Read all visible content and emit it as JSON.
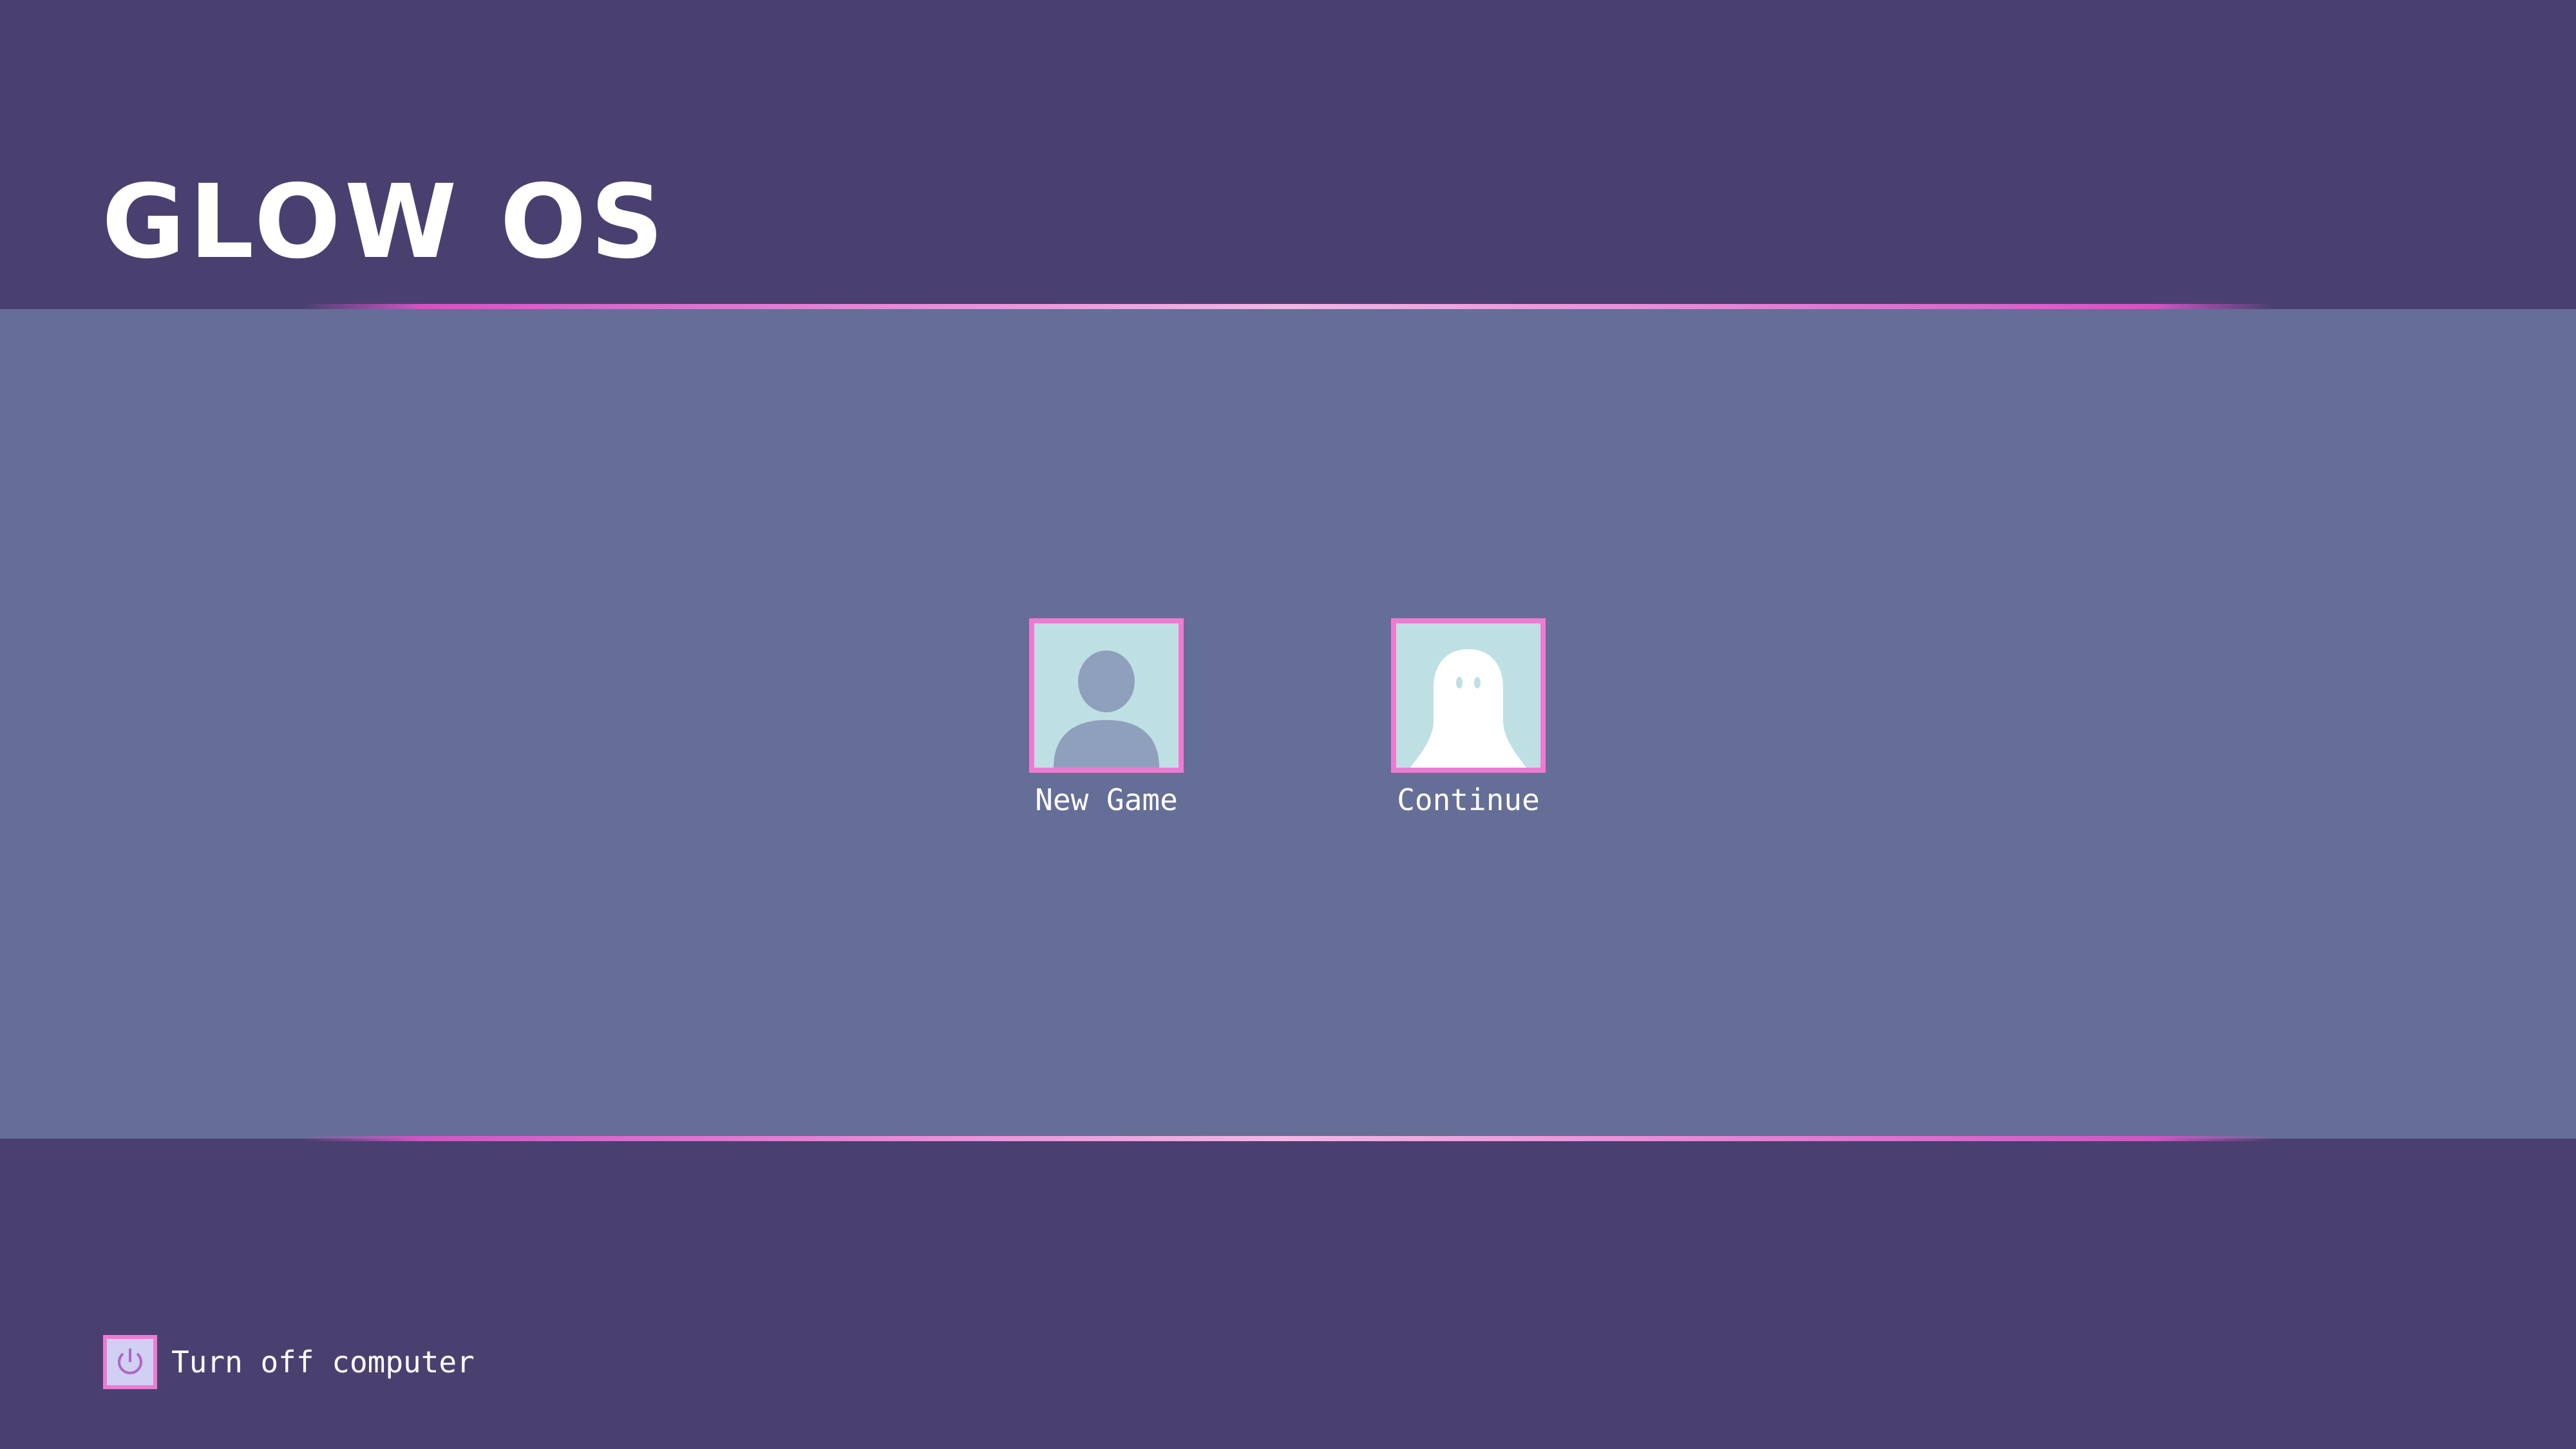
{
  "app": {
    "title": "GLOW OS"
  },
  "colors": {
    "background": "#4a4070",
    "band": "#656e96",
    "accent_pink": "#f07ad2",
    "avatar_bg": "#bfe0e3",
    "avatar_silhouette": "#8fa0bc",
    "text": "#ffffff"
  },
  "profiles": [
    {
      "label": "New Game",
      "icon": "person-silhouette-icon"
    },
    {
      "label": "Continue",
      "icon": "ghost-icon"
    }
  ],
  "footer": {
    "power_label": "Turn off computer",
    "power_icon": "power-icon"
  }
}
